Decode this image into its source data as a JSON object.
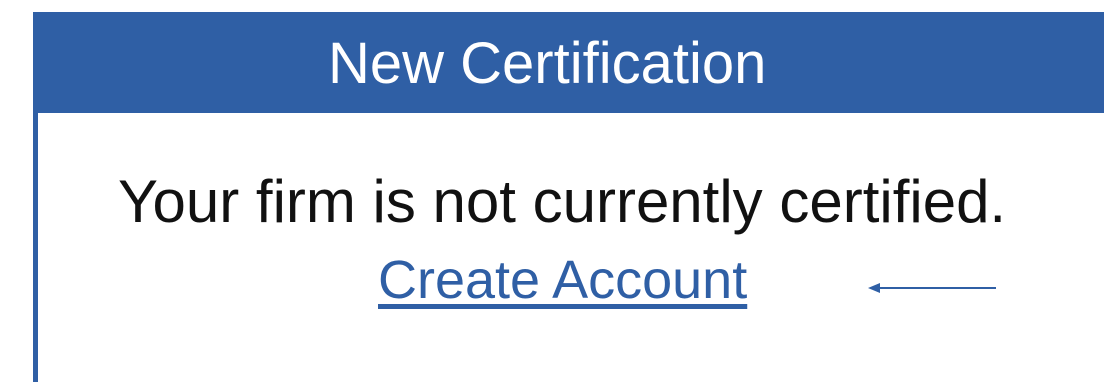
{
  "panel": {
    "header_title": "New Certification",
    "status_message": "Your firm is not currently certified.",
    "create_account_link": "Create Account",
    "arrow_icon": "left-arrow-icon",
    "colors": {
      "header_bg": "#2f5fa5",
      "header_text": "#ffffff",
      "link": "#2f5fa5",
      "text": "#111111"
    }
  }
}
